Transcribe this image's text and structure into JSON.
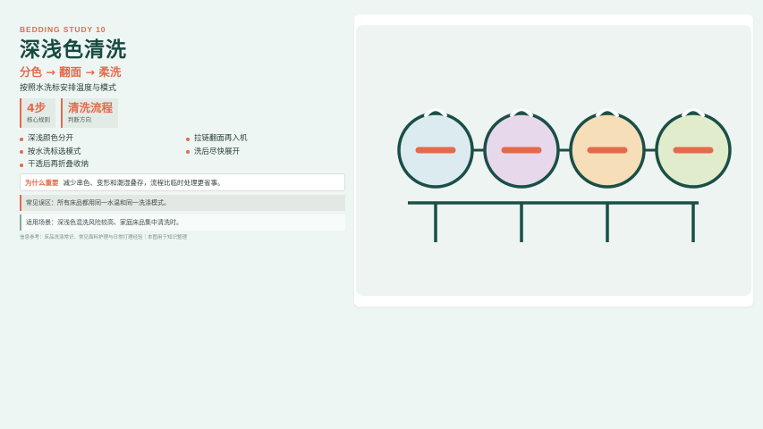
{
  "eyebrow": "BEDDING STUDY 10",
  "title": "深浅色清洗",
  "subtitle": "分色 → 翻面 → 柔洗",
  "description": "按照水洗标安排温度与模式",
  "stats": [
    {
      "value": "4步",
      "label": "核心规则"
    },
    {
      "value": "清洗流程",
      "label": "判断方向"
    }
  ],
  "bullets": [
    "深浅颜色分开",
    "拉链翻面再入机",
    "按水洗标选模式",
    "洗后尽快展开",
    "干透后再折叠收纳"
  ],
  "why": {
    "label": "为什么重要",
    "text": "减少串色、变形和潮湿叠存，流程比临时处理更省事。"
  },
  "notes": {
    "warning": "常见误区：所有床品都用同一水温和同一洗涤模式。",
    "usage": "适用场景：深浅色混洗风险较高、家庭床品集中清洗时。"
  },
  "source": "信息参考：床品洗涤常识、常见面料护理与日常打理经验｜本图用于知识整理",
  "illustration": {
    "drum_colors": [
      "#dcebef",
      "#e8d8ec",
      "#f5deb8",
      "#e0eccc"
    ],
    "outline_color": "#1a4f47",
    "accent_color": "#e46a4b",
    "icon": "washing-drums-on-rack"
  }
}
